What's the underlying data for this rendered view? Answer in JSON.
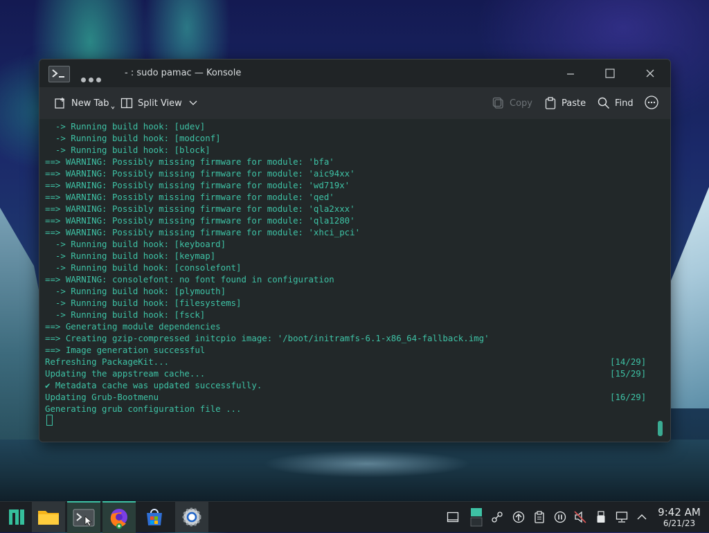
{
  "window": {
    "title": "- : sudo pamac — Konsole"
  },
  "toolbar": {
    "new_tab": "New Tab",
    "split_view": "Split View",
    "copy": "Copy",
    "paste": "Paste",
    "find": "Find"
  },
  "terminal": {
    "accent": "#3ec2a5",
    "lines": [
      {
        "text": "  -> Running build hook: [udev]"
      },
      {
        "text": "  -> Running build hook: [modconf]"
      },
      {
        "text": "  -> Running build hook: [block]"
      },
      {
        "text": "==> WARNING: Possibly missing firmware for module: 'bfa'"
      },
      {
        "text": "==> WARNING: Possibly missing firmware for module: 'aic94xx'"
      },
      {
        "text": "==> WARNING: Possibly missing firmware for module: 'wd719x'"
      },
      {
        "text": "==> WARNING: Possibly missing firmware for module: 'qed'"
      },
      {
        "text": "==> WARNING: Possibly missing firmware for module: 'qla2xxx'"
      },
      {
        "text": "==> WARNING: Possibly missing firmware for module: 'qla1280'"
      },
      {
        "text": "==> WARNING: Possibly missing firmware for module: 'xhci_pci'"
      },
      {
        "text": "  -> Running build hook: [keyboard]"
      },
      {
        "text": "  -> Running build hook: [keymap]"
      },
      {
        "text": "  -> Running build hook: [consolefont]"
      },
      {
        "text": "==> WARNING: consolefont: no font found in configuration"
      },
      {
        "text": "  -> Running build hook: [plymouth]"
      },
      {
        "text": "  -> Running build hook: [filesystems]"
      },
      {
        "text": "  -> Running build hook: [fsck]"
      },
      {
        "text": "==> Generating module dependencies"
      },
      {
        "text": "==> Creating gzip-compressed initcpio image: '/boot/initramfs-6.1-x86_64-fallback.img'"
      },
      {
        "text": "==> Image generation successful"
      },
      {
        "text": "Refreshing PackageKit...",
        "progress": "[14/29]"
      },
      {
        "text": "Updating the appstream cache...",
        "progress": "[15/29]"
      },
      {
        "text": "✔ Metadata cache was updated successfully."
      },
      {
        "text": "Updating Grub-Bootmenu",
        "progress": "[16/29]"
      },
      {
        "text": "Generating grub configuration file ..."
      }
    ]
  },
  "taskbar": {
    "apps": [
      {
        "icon": "manjaro-logo-icon"
      },
      {
        "icon": "folder-icon"
      },
      {
        "icon": "terminal-icon"
      },
      {
        "icon": "firefox-icon"
      },
      {
        "icon": "store-icon"
      },
      {
        "icon": "settings-icon"
      }
    ],
    "tray_icons": [
      "show-desktop-icon",
      "pager-icon",
      "kde-connect-icon",
      "updates-icon",
      "clipboard-icon",
      "media-pause-icon",
      "volume-muted-icon",
      "usb-icon",
      "network-icon",
      "tray-expand-icon"
    ],
    "clock": {
      "time": "9:42 AM",
      "date": "6/21/23"
    }
  }
}
